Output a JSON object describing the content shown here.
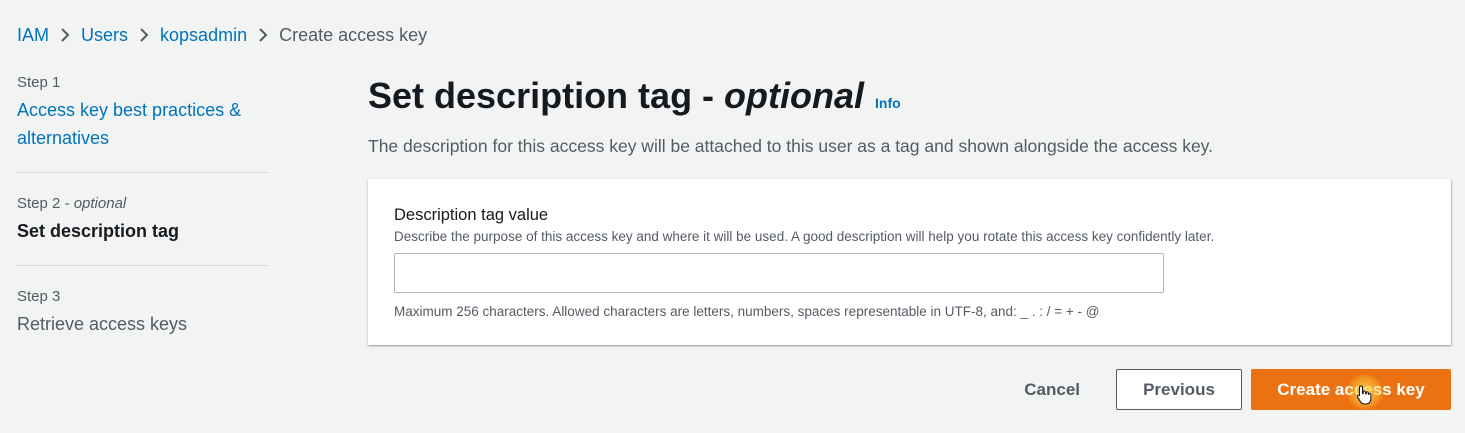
{
  "breadcrumb": {
    "items": [
      "IAM",
      "Users",
      "kopsadmin"
    ],
    "current": "Create access key"
  },
  "steps": [
    {
      "number": "Step 1",
      "title": "Access key best practices & alternatives"
    },
    {
      "number": "Step 2",
      "optional": "- optional",
      "title": "Set description tag"
    },
    {
      "number": "Step 3",
      "title": "Retrieve access keys"
    }
  ],
  "header": {
    "title": "Set description tag -",
    "title_optional": "optional",
    "info": "Info",
    "description": "The description for this access key will be attached to this user as a tag and shown alongside the access key."
  },
  "form": {
    "label": "Description tag value",
    "help": "Describe the purpose of this access key and where it will be used. A good description will help you rotate this access key confidently later.",
    "value": "",
    "placeholder": "",
    "constraint": "Maximum 256 characters. Allowed characters are letters, numbers, spaces representable in UTF-8, and: _ . : / = + - @"
  },
  "actions": {
    "cancel": "Cancel",
    "previous": "Previous",
    "create": "Create access key"
  },
  "colors": {
    "link": "#0073bb",
    "primary": "#ec7211",
    "background": "#f2f3f3",
    "text": "#16191f",
    "muted": "#545b64"
  }
}
